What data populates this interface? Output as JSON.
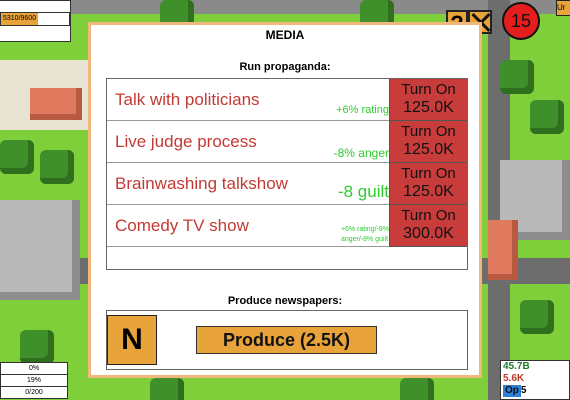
{
  "hud": {
    "money_text": "5310/9600",
    "money_fraction": 0.55,
    "help_label": "?",
    "counter": "15",
    "corner_label": "Ur"
  },
  "stats_left": [
    "0%",
    "19%",
    "0/200"
  ],
  "stats_right": {
    "line1": "45.7B",
    "line2": "5.6K",
    "line3_badge": "Op",
    "line3_value": "5"
  },
  "dialog": {
    "title": "MEDIA",
    "propaganda_title": "Run propaganda:",
    "propaganda": [
      {
        "name": "Talk with politicians",
        "effect": "+6% rating",
        "button_line1": "Turn On",
        "button_line2": "125.0K"
      },
      {
        "name": "Live judge process",
        "effect": "-8% anger",
        "button_line1": "Turn On",
        "button_line2": "125.0K"
      },
      {
        "name": "Brainwashing talkshow",
        "effect": "-8 guilt",
        "button_line1": "Turn On",
        "button_line2": "125.0K"
      },
      {
        "name": "Comedy TV show",
        "effect_line1": "+6% rating/-8%",
        "effect_line2": "anger/-8% guilt",
        "button_line1": "Turn On",
        "button_line2": "300.0K"
      }
    ],
    "newspapers_title": "Produce newspapers:",
    "newspaper_badge": "N",
    "produce_label": "Produce (2.5K)"
  },
  "colors": {
    "accent_orange": "#e8a33a",
    "button_red": "#c83c3c",
    "item_text_red": "#c33a34",
    "effect_green": "#2ecc2e",
    "counter_red": "#e41e1e"
  }
}
